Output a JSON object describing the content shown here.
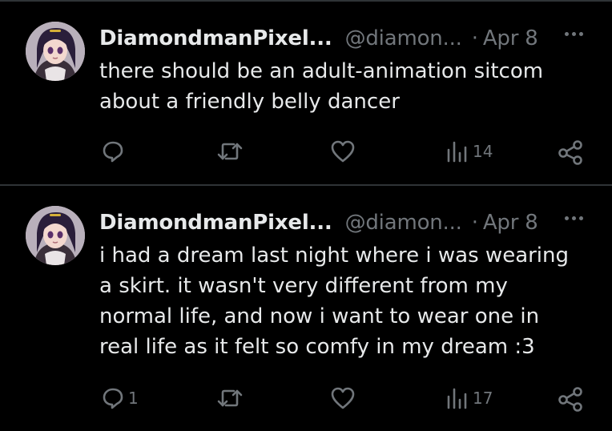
{
  "posts": [
    {
      "author": "DiamondmanPixel...",
      "handle": "@diamon...",
      "separator": "·",
      "date": "Apr 8",
      "text": "there should be an adult-animation sitcom\nabout a friendly belly dancer",
      "reply_count": "",
      "views_count": "14"
    },
    {
      "author": "DiamondmanPixel...",
      "handle": "@diamon...",
      "separator": "·",
      "date": "Apr 8",
      "text": "i had a dream last night where i was wearing\na skirt. it wasn't very different from my\nnormal life, and now i want to wear one in\nreal life as it felt so comfy in my dream :3",
      "reply_count": "1",
      "views_count": "17"
    }
  ],
  "icons": {
    "reply": "reply-icon",
    "repost": "repost-icon",
    "like": "heart-icon",
    "views": "views-icon",
    "share": "share-icon",
    "more": "more-icon"
  },
  "colors": {
    "background": "#000000",
    "text": "#e7e9ea",
    "muted": "#71767b",
    "divider": "#2f3336"
  }
}
